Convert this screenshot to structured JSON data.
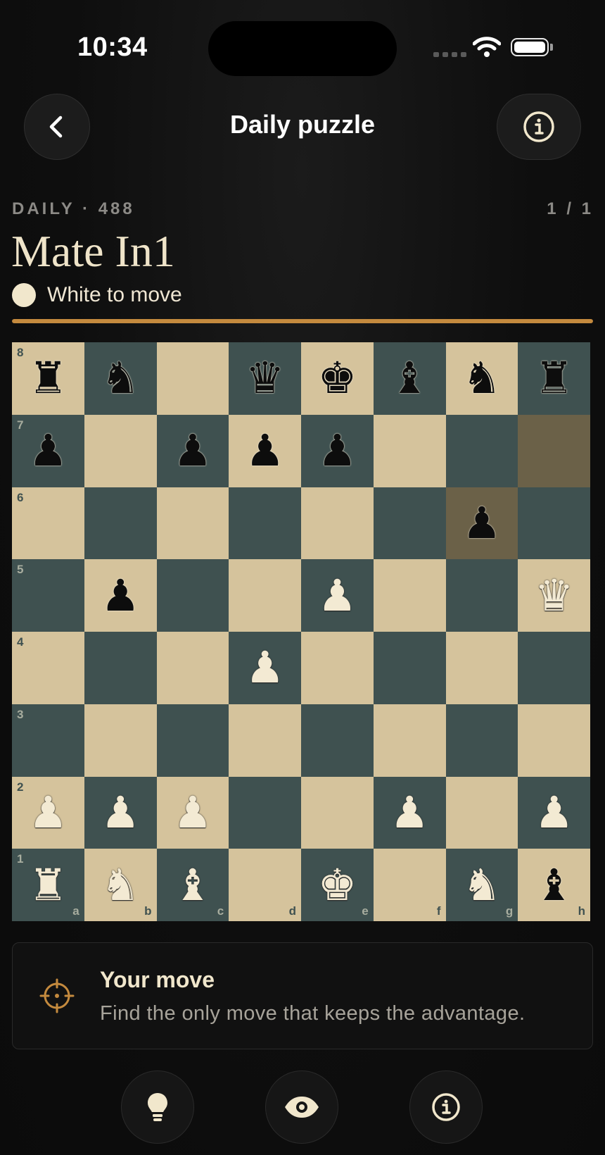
{
  "status": {
    "time": "10:34"
  },
  "nav": {
    "title": "Daily puzzle",
    "back_icon": "chevron-left-icon",
    "info_icon": "info-icon"
  },
  "puzzle": {
    "meta": "DAILY · 488",
    "count": "1 / 1",
    "title": "Mate In1",
    "turn": "White to move",
    "progress_fraction": 1.0,
    "accent_color": "#c48a3e"
  },
  "board": {
    "ranks": [
      "8",
      "7",
      "6",
      "5",
      "4",
      "3",
      "2",
      "1"
    ],
    "files": [
      "a",
      "b",
      "c",
      "d",
      "e",
      "f",
      "g",
      "h"
    ],
    "light_color": "#d5c39c",
    "dark_color": "#3f5150",
    "highlight_color": "#6b6148",
    "highlighted_squares": [
      "h7",
      "g6"
    ],
    "pieces": {
      "a8": "bR",
      "b8": "bN",
      "d8": "bQ",
      "e8": "bK",
      "f8": "bB",
      "g8": "bN",
      "h8": "bR",
      "a7": "bP",
      "c7": "bP",
      "d7": "bP",
      "e7": "bP",
      "g6": "bP",
      "b5": "bP",
      "e5": "wP",
      "h5": "wQ",
      "d4": "wP",
      "a2": "wP",
      "b2": "wP",
      "c2": "wP",
      "f2": "wP",
      "h2": "wP",
      "a1": "wR",
      "b1": "wN",
      "c1": "wB",
      "e1": "wK",
      "g1": "wN",
      "h1": "bB"
    }
  },
  "hint_card": {
    "title": "Your move",
    "body": "Find the only move that keeps the advantage.",
    "icon": "crosshair-icon"
  },
  "actions": [
    {
      "icon": "lightbulb-icon"
    },
    {
      "icon": "eye-icon"
    },
    {
      "icon": "info-icon"
    }
  ]
}
